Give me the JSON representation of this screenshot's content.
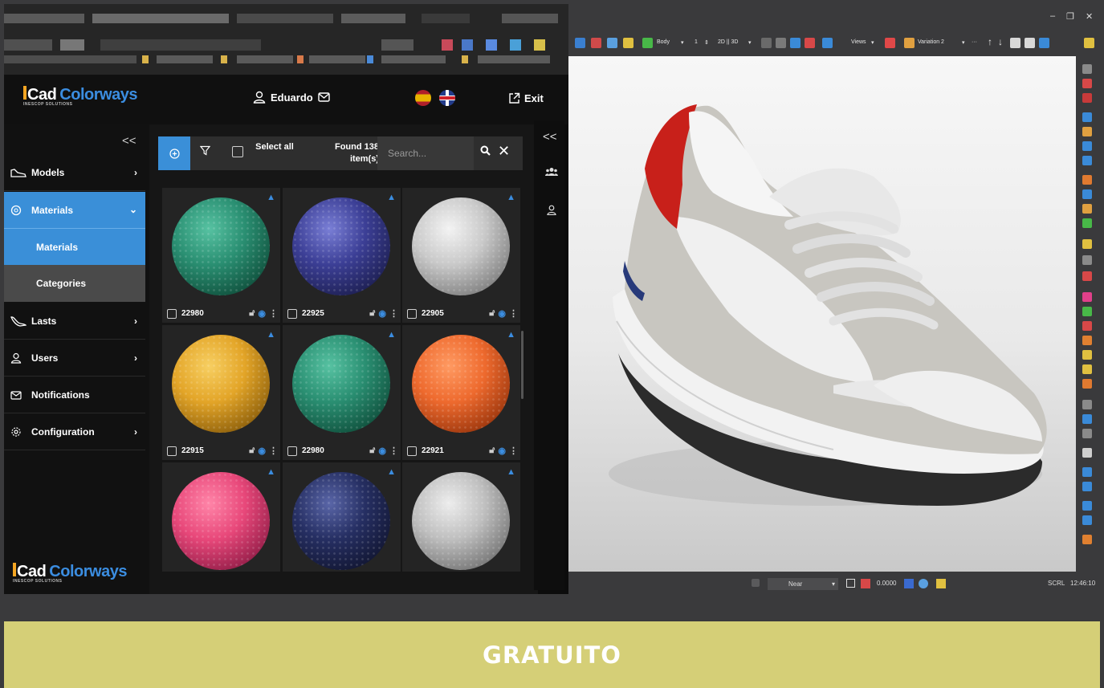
{
  "app": {
    "brand_cad": "Cad",
    "brand_colorways": "Colorways",
    "brand_sub": "INESCOP SOLUTIONS",
    "user_name": "Eduardo",
    "exit_label": "Exit",
    "flags": [
      "es-flag",
      "uk-flag"
    ]
  },
  "sidebar": {
    "collapse_icon": "chevrons-left-icon",
    "items": [
      {
        "label": "Models",
        "icon": "shoe-icon",
        "chevron": "›"
      },
      {
        "label": "Materials",
        "icon": "material-icon",
        "chevron": "⌄",
        "expanded": true
      },
      {
        "label": "Lasts",
        "icon": "last-icon",
        "chevron": "›"
      },
      {
        "label": "Users",
        "icon": "user-icon",
        "chevron": "›"
      },
      {
        "label": "Notifications",
        "icon": "mail-icon",
        "chevron": ""
      },
      {
        "label": "Configuration",
        "icon": "gear-icon",
        "chevron": "›"
      }
    ],
    "sub_items": [
      {
        "label": "Materials",
        "selected": true
      },
      {
        "label": "Categories",
        "selected": false
      }
    ]
  },
  "toolbar": {
    "select_all_label": "Select all",
    "found_label": "Found 138 item(s)",
    "search_placeholder": "Search..."
  },
  "materials": [
    {
      "code": "22980",
      "color": "#2a8f72"
    },
    {
      "code": "22925",
      "color": "#3c3f96"
    },
    {
      "code": "22905",
      "color": "#c9c9c9"
    },
    {
      "code": "22915",
      "color": "#e3a528"
    },
    {
      "code": "22980",
      "color": "#2a8f72"
    },
    {
      "code": "22921",
      "color": "#ee6a2e"
    },
    {
      "code": "",
      "color": "#e8487a"
    },
    {
      "code": "",
      "color": "#262f63"
    },
    {
      "code": "",
      "color": "#bfbfbf"
    }
  ],
  "cad": {
    "toolbar_labels": {
      "body": "Body",
      "num": "1",
      "mode": "2D || 3D",
      "views": "Views",
      "variation": "Variation 2"
    },
    "status": {
      "near": "Near",
      "value": "0.0000",
      "scrl": "SCRL",
      "time": "12:46:10"
    }
  },
  "banner": {
    "text": "GRATUITO",
    "color": "#d5cf77"
  }
}
